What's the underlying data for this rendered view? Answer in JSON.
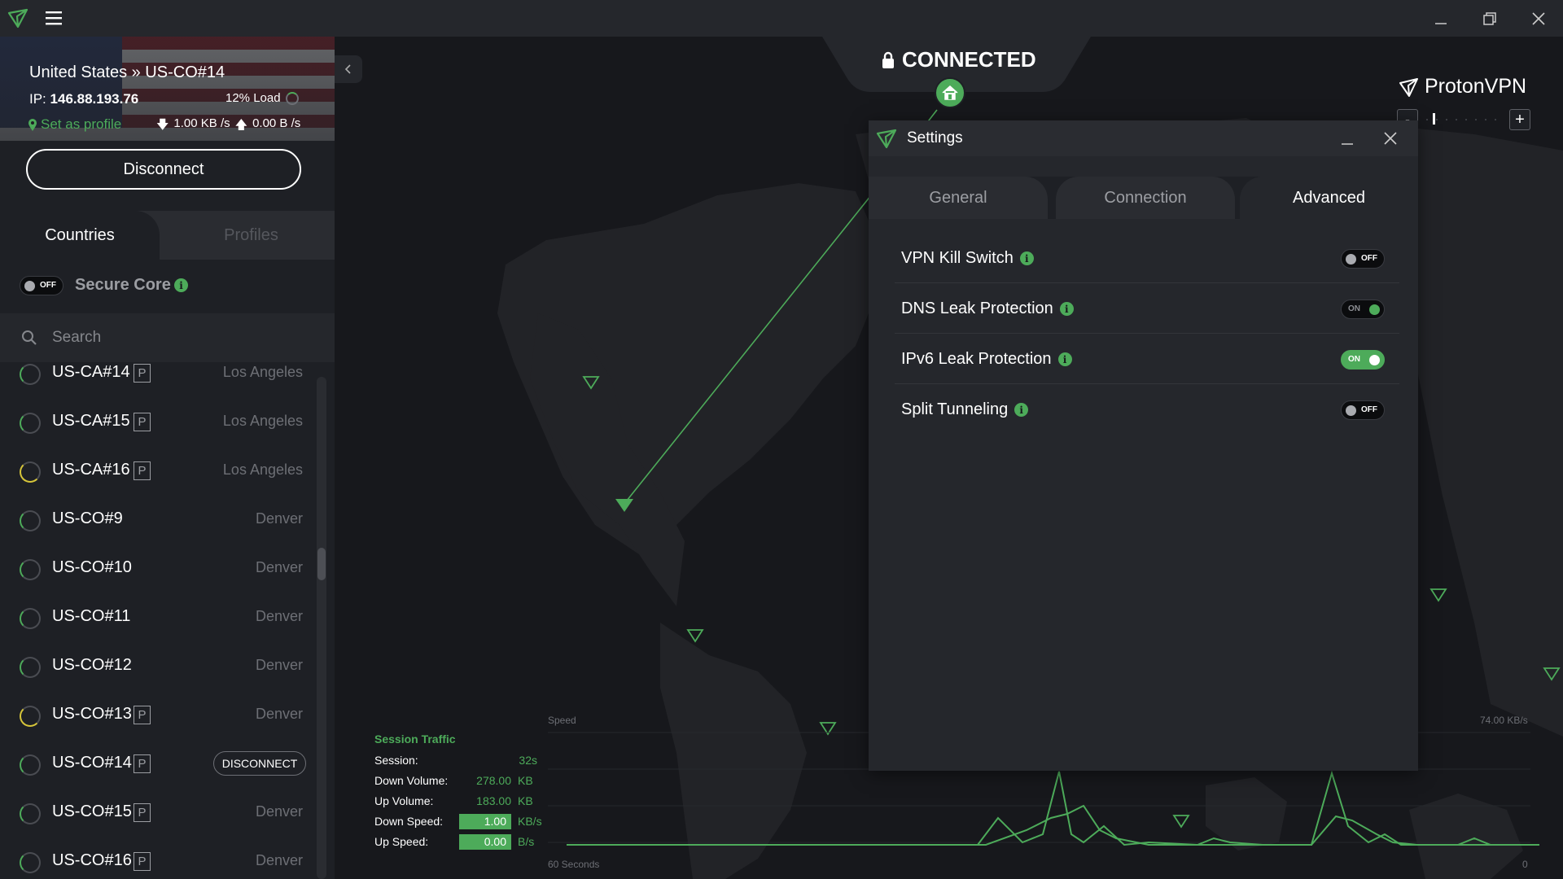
{
  "window": {
    "minimize_icon": "minimize-icon",
    "maximize_icon": "restore-icon",
    "close_icon": "close-icon"
  },
  "connection": {
    "title": "United States » US-CO#14",
    "ip_label": "IP:",
    "ip": "146.88.193.76",
    "load": "12% Load",
    "set_profile": "Set as profile",
    "download": "1.00 KB /s",
    "upload": "0.00 B /s",
    "disconnect": "Disconnect"
  },
  "sidebar": {
    "tabs": [
      "Countries",
      "Profiles"
    ],
    "secure_core": {
      "label": "Secure Core",
      "toggle": "OFF"
    },
    "search_placeholder": "Search",
    "servers": [
      {
        "name": "US-CA#14",
        "p": "P",
        "city": "Los Angeles",
        "load": "low"
      },
      {
        "name": "US-CA#15",
        "p": "P",
        "city": "Los Angeles",
        "load": "low"
      },
      {
        "name": "US-CA#16",
        "p": "P",
        "city": "Los Angeles",
        "load": "mid"
      },
      {
        "name": "US-CO#9",
        "p": "",
        "city": "Denver",
        "load": "low"
      },
      {
        "name": "US-CO#10",
        "p": "",
        "city": "Denver",
        "load": "low"
      },
      {
        "name": "US-CO#11",
        "p": "",
        "city": "Denver",
        "load": "low"
      },
      {
        "name": "US-CO#12",
        "p": "",
        "city": "Denver",
        "load": "low"
      },
      {
        "name": "US-CO#13",
        "p": "P",
        "city": "Denver",
        "load": "mid"
      },
      {
        "name": "US-CO#14",
        "p": "P",
        "city": "",
        "action": "DISCONNECT",
        "load": "low"
      },
      {
        "name": "US-CO#15",
        "p": "P",
        "city": "Denver",
        "load": "low"
      },
      {
        "name": "US-CO#16",
        "p": "P",
        "city": "Denver",
        "load": "low"
      }
    ]
  },
  "map": {
    "status": "CONNECTED",
    "brand": "ProtonVPN",
    "zoom_minus": "-",
    "zoom_plus": "+"
  },
  "settings": {
    "title": "Settings",
    "tabs": [
      "General",
      "Connection",
      "Advanced"
    ],
    "active_tab": "Advanced",
    "options": [
      {
        "label": "VPN Kill Switch",
        "state": "OFF"
      },
      {
        "label": "DNS Leak Protection",
        "state": "ON"
      },
      {
        "label": "IPv6 Leak Protection",
        "state": "ON"
      },
      {
        "label": "Split Tunneling",
        "state": "OFF"
      }
    ]
  },
  "traffic": {
    "title": "Session Traffic",
    "rows": [
      {
        "label": "Session:",
        "value": "32s",
        "unit": ""
      },
      {
        "label": "Down Volume:",
        "value": "278.00",
        "unit": "KB"
      },
      {
        "label": "Up Volume:",
        "value": "183.00",
        "unit": "KB"
      },
      {
        "label": "Down Speed:",
        "value": "1.00",
        "unit": "KB/s"
      },
      {
        "label": "Up Speed:",
        "value": "0.00",
        "unit": "B/s"
      }
    ],
    "graph_label": "Speed",
    "graph_max": "74.00  KB/s",
    "graph_span": "60 Seconds",
    "graph_zero": "0"
  },
  "colors": {
    "accent": "#4dab5a",
    "background": "#17181c",
    "panel": "#25272c"
  }
}
